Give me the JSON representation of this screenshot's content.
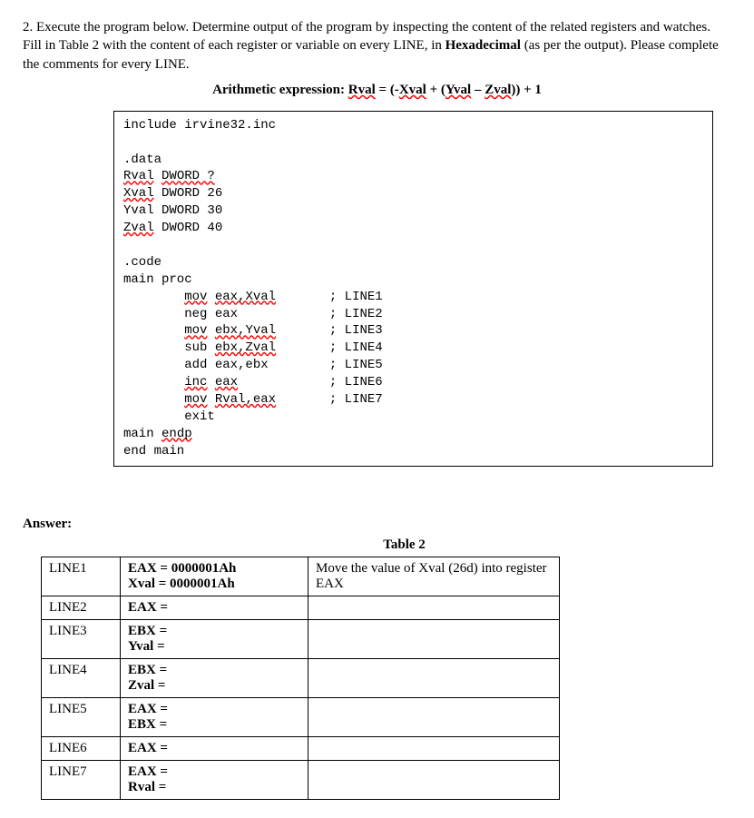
{
  "prompt": {
    "question_num": "2.",
    "text1": "Execute the program below. Determine output of the program by inspecting the content of the related registers and watches. Fill in Table 2 with the content of each register or variable on every LINE, in ",
    "text2": "Hexadecimal",
    "text3": " (as per the output). Please complete the comments for every LINE."
  },
  "arith": {
    "label": "Arithmetic expression: ",
    "eq_p1": "Rval",
    "eq_p2": " = (-",
    "eq_p3": "Xval",
    "eq_p4": " + (",
    "eq_p5": "Yval",
    "eq_p6": " – ",
    "eq_p7": "Zval",
    "eq_p8": ")) + 1"
  },
  "code": {
    "include": "include irvine32.inc",
    "data_hdr": ".data",
    "rval_decl_a": "Rval",
    "rval_decl_b": " ",
    "rval_decl_c": "DWORD ?",
    "xval_decl_a": "Xval",
    "xval_decl_b": " DWORD 26",
    "yval_decl": "Yval DWORD 30",
    "zval_decl_a": "Zval",
    "zval_decl_b": " DWORD 40",
    "code_hdr": ".code",
    "main_proc": "main proc",
    "l1_a": "        ",
    "l1_b": "mov",
    "l1_c": " ",
    "l1_d": "eax,Xval",
    "l1_e": "       ; LINE1",
    "l2": "        neg eax            ; LINE2",
    "l3_a": "        ",
    "l3_b": "mov",
    "l3_c": " ",
    "l3_d": "ebx,Yval",
    "l3_e": "       ; LINE3",
    "l4_a": "        sub ",
    "l4_b": "ebx,Zval",
    "l4_c": "       ; LINE4",
    "l5": "        add eax,ebx        ; LINE5",
    "l6_a": "        ",
    "l6_b": "inc",
    "l6_c": " ",
    "l6_d": "eax",
    "l6_e": "            ; LINE6",
    "l7_a": "        ",
    "l7_b": "mov",
    "l7_c": " ",
    "l7_d": "Rval,eax",
    "l7_e": "       ; LINE7",
    "exit": "        exit",
    "main_endp_a": "main ",
    "main_endp_b": "endp",
    "end_main": "end main"
  },
  "answer_label": "Answer:",
  "table_title": "Table 2",
  "table": {
    "rows": [
      {
        "line": "LINE1",
        "regs": "EAX = 0000001Ah\nXval = 0000001Ah",
        "comment": "Move the value of Xval (26d) into register EAX"
      },
      {
        "line": "LINE2",
        "regs": "EAX =",
        "comment": ""
      },
      {
        "line": "LINE3",
        "regs": "EBX =\nYval =",
        "comment": ""
      },
      {
        "line": "LINE4",
        "regs": "EBX =\nZval =",
        "comment": ""
      },
      {
        "line": "LINE5",
        "regs": "EAX =\nEBX =",
        "comment": ""
      },
      {
        "line": "LINE6",
        "regs": "EAX =",
        "comment": ""
      },
      {
        "line": "LINE7",
        "regs": "EAX =\nRval =",
        "comment": ""
      }
    ]
  }
}
